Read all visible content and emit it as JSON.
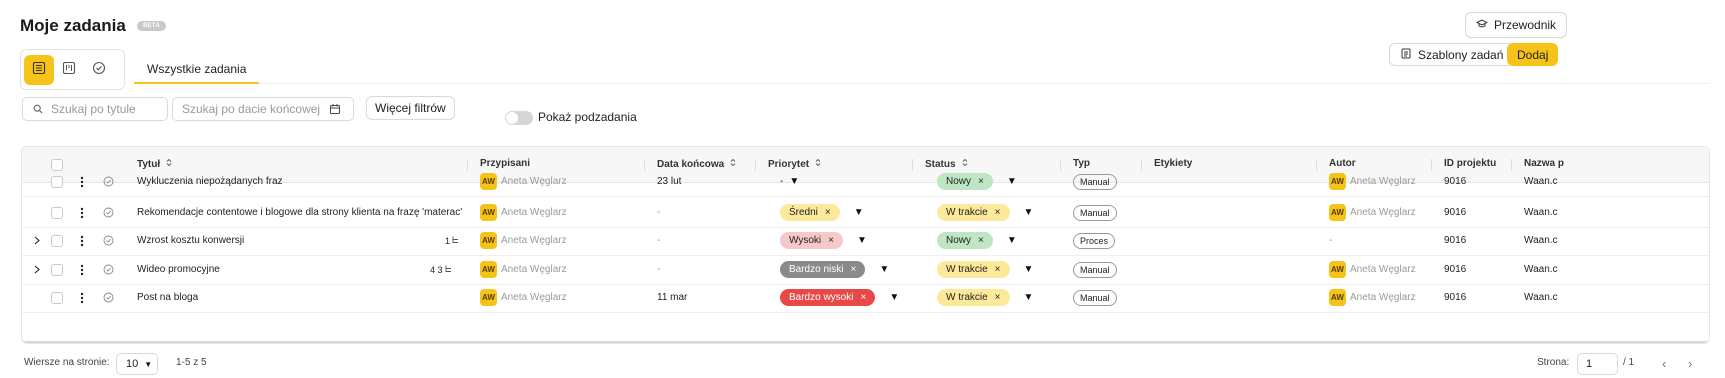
{
  "header": {
    "title": "Moje zadania",
    "beta": "BETA",
    "guide_label": "Przewodnik",
    "templates_label": "Szablony zadań",
    "add_label": "Dodaj"
  },
  "tabs": {
    "active": "Wszystkie zadania"
  },
  "filters": {
    "search_title_placeholder": "Szukaj po tytule",
    "search_date_placeholder": "Szukaj po dacie końcowej",
    "more_filters_label": "Więcej filtrów",
    "subtasks_label": "Pokaż podzadania"
  },
  "table": {
    "columns": [
      "Tytuł",
      "Przypisani",
      "Data końcowa",
      "Priorytet",
      "Status",
      "Typ",
      "Etykiety",
      "Autor",
      "ID projektu",
      "Nazwa p"
    ],
    "rows": [
      {
        "title": "Wykluczenia niepożądanych fraz",
        "meta": "",
        "assignee": "Aneta Węglarz",
        "initials": "AW",
        "due": "23 lut",
        "priority": "-",
        "status": "Nowy",
        "type": "Manual",
        "author": "Aneta Węglarz",
        "author_initials": "AW",
        "project_id": "9016",
        "project_name": "Waan.c"
      },
      {
        "title": "Rekomendacje contentowe i blogowe dla strony klienta na frazę 'materac'",
        "meta": "",
        "assignee": "Aneta Węglarz",
        "initials": "AW",
        "due": "-",
        "priority": "Średni",
        "status": "W trakcie",
        "type": "Manual",
        "author": "Aneta Węglarz",
        "author_initials": "AW",
        "project_id": "9016",
        "project_name": "Waan.c"
      },
      {
        "title": "Wzrost kosztu konwersji",
        "meta": "1",
        "assignee": "Aneta Węglarz",
        "initials": "AW",
        "due": "-",
        "priority": "Wysoki",
        "status": "Nowy",
        "type": "Proces",
        "author": "-",
        "author_initials": "",
        "project_id": "9016",
        "project_name": "Waan.c"
      },
      {
        "title": "Wideo promocyjne",
        "meta": "4  3",
        "assignee": "Aneta Węglarz",
        "initials": "AW",
        "due": "-",
        "priority": "Bardzo niski",
        "status": "W trakcie",
        "type": "Manual",
        "author": "Aneta Węglarz",
        "author_initials": "AW",
        "project_id": "9016",
        "project_name": "Waan.c"
      },
      {
        "title": "Post na bloga",
        "meta": "",
        "assignee": "Aneta Węglarz",
        "initials": "AW",
        "due": "11 mar",
        "priority": "Bardzo wysoki",
        "status": "W trakcie",
        "type": "Manual",
        "author": "Aneta Węglarz",
        "author_initials": "AW",
        "project_id": "9016",
        "project_name": "Waan.c"
      }
    ]
  },
  "footer": {
    "rows_per_page_label": "Wiersze na stronie:",
    "rows_per_page": "10",
    "range": "1-5 z 5",
    "page_label": "Strona:",
    "page": "1",
    "page_total": "/ 1"
  },
  "colors": {
    "accent": "#f6c31a",
    "nowy": "#bfe6c2",
    "w_trakcie": "#fde99a",
    "sredni": "#fde99a",
    "wysoki": "#f7c8c8",
    "bardzo_niski": "#8a8a8a",
    "bardzo_wysoki": "#e74848"
  }
}
